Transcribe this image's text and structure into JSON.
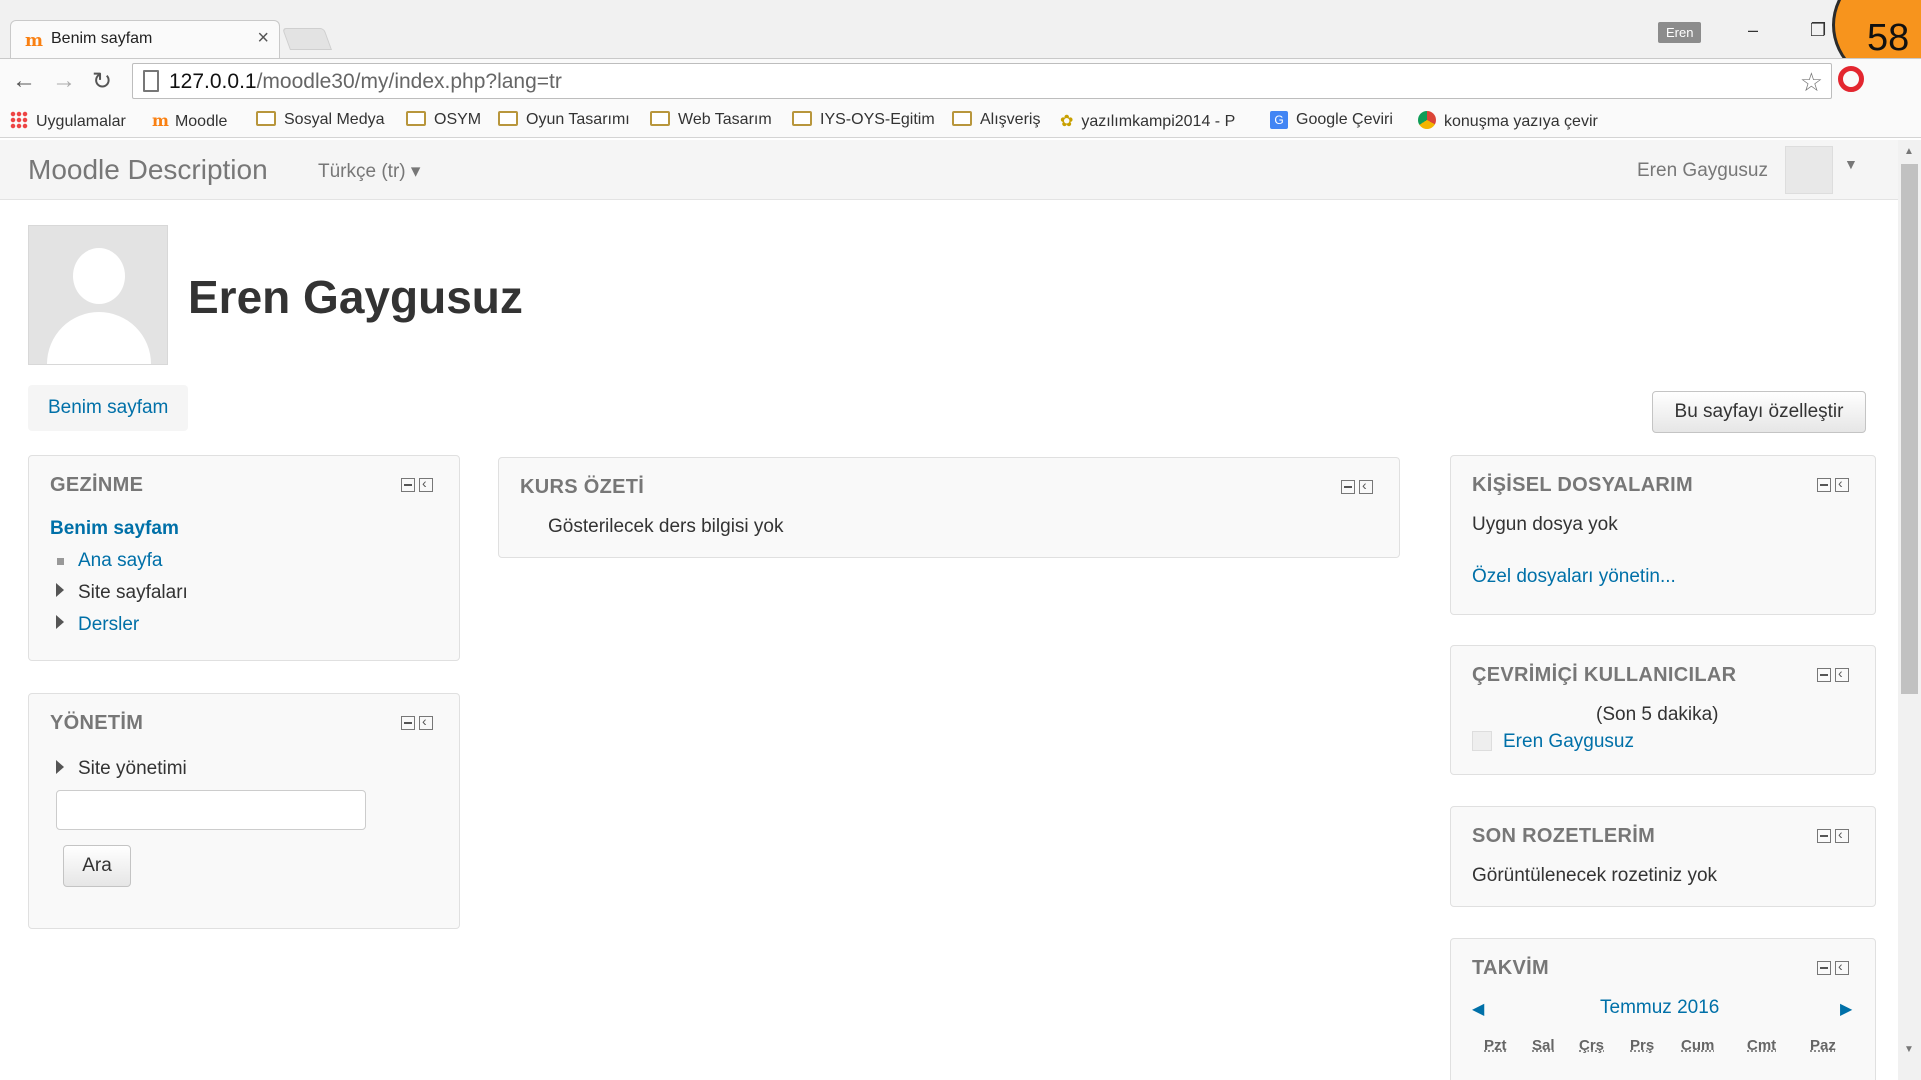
{
  "browser": {
    "tab_title": "Benim sayfam",
    "tab_close": "×",
    "profile_name": "Eren",
    "minimize": "–",
    "restore": "❐",
    "overlay_counter": "58",
    "url_host": "127.0.0.1",
    "url_path": "/moodle30/my/index.php?lang=tr",
    "bookmarks": [
      {
        "label": "Uygulamalar",
        "icon": "apps-grid-icon"
      },
      {
        "label": "Moodle",
        "icon": "moodle-icon"
      },
      {
        "label": "Sosyal Medya",
        "icon": "folder-icon"
      },
      {
        "label": "OSYM",
        "icon": "folder-icon"
      },
      {
        "label": "Oyun Tasarımı",
        "icon": "folder-icon"
      },
      {
        "label": "Web Tasarım",
        "icon": "folder-icon"
      },
      {
        "label": "IYS-OYS-Egitim",
        "icon": "folder-icon"
      },
      {
        "label": "Alışveriş",
        "icon": "folder-icon"
      },
      {
        "label": "yazılımkampi2014 - P",
        "icon": "camp-icon"
      },
      {
        "label": "Google Çeviri",
        "icon": "google-translate-icon"
      },
      {
        "label": "konuşma yazıya çevir",
        "icon": "chrome-icon"
      }
    ]
  },
  "navbar": {
    "brand": "Moodle Description",
    "language": "Türkçe (tr) ▾",
    "user_name": "Eren Gaygusuz"
  },
  "header": {
    "full_name": "Eren Gaygusuz",
    "breadcrumb": "Benim sayfam",
    "customize_button": "Bu sayfayı özelleştir"
  },
  "blocks": {
    "navigation": {
      "title": "GEZİNME",
      "active": "Benim sayfam",
      "items": [
        "Ana sayfa",
        "Site sayfaları",
        "Dersler"
      ]
    },
    "administration": {
      "title": "YÖNETİM",
      "item": "Site yönetimi",
      "search_button": "Ara",
      "search_value": ""
    },
    "course_overview": {
      "title": "KURS ÖZETİ",
      "empty": "Gösterilecek ders bilgisi yok"
    },
    "private_files": {
      "title": "KİŞİSEL DOSYALARIM",
      "empty": "Uygun dosya yok",
      "manage_link": "Özel dosyaları yönetin..."
    },
    "online_users": {
      "title": "ÇEVRİMİÇİ KULLANICILAR",
      "period": "(Son 5 dakika)",
      "users": [
        "Eren Gaygusuz"
      ]
    },
    "badges": {
      "title": "SON ROZETLERİM",
      "empty": "Görüntülenecek rozetiniz yok"
    },
    "calendar": {
      "title": "TAKVİM",
      "month": "Temmuz 2016",
      "prev": "◀",
      "next": "▶",
      "days": [
        "Pzt",
        "Sal",
        "Çrş",
        "Prş",
        "Cum",
        "Cmt",
        "Paz"
      ]
    }
  },
  "colors": {
    "link": "#0070a8",
    "block_bg": "#f9f9f9",
    "heading_muted": "#777777"
  }
}
